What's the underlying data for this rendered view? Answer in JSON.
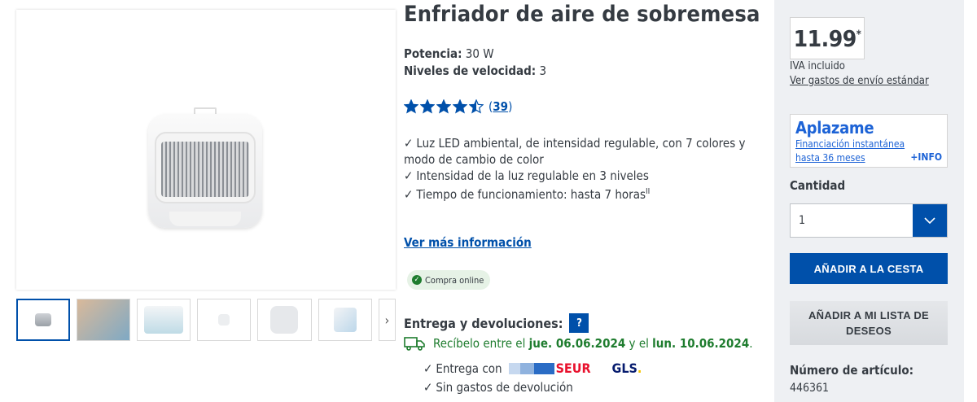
{
  "product": {
    "title": "Enfriador de aire de sobremesa",
    "specs": [
      {
        "label": "Potencia:",
        "value": "30 W"
      },
      {
        "label": "Niveles de velocidad:",
        "value": "3"
      }
    ],
    "rating": {
      "value": 4.5,
      "max": 5,
      "count": "39"
    },
    "features": [
      "Luz LED ambiental, de intensidad regulable, con 7 colores y modo de cambio de color",
      "Intensidad de la luz regulable en 3 niveles",
      "Tiempo de funcionamiento: hasta 7 horas"
    ],
    "feature_footnote": "II",
    "more_info": "Ver más información",
    "badge": "Compra online"
  },
  "delivery": {
    "heading": "Entrega y devoluciones:",
    "help": "?",
    "date_prefix": "Recíbelo entre el",
    "date_from": "jue. 06.06.2024",
    "date_mid": "y el",
    "date_to": "lun. 10.06.2024",
    "date_suffix": ".",
    "carrier_label": "Entrega con",
    "carrier1": "SEUR",
    "carrier2": "GLS",
    "carrier2_dot": ".",
    "returns": "Sin gastos de devolución"
  },
  "sidebar": {
    "price": "11.99",
    "price_mark": "*",
    "vat": "IVA incluido",
    "shipping_link": "Ver gastos de envío estándar",
    "financing": {
      "brand": "Aplazame",
      "line1": "Financiación instantánea",
      "line2": "hasta 36 meses",
      "info": "+INFO"
    },
    "quantity_label": "Cantidad",
    "quantity_value": "1",
    "add_to_cart": "AÑADIR A LA CESTA",
    "add_to_wishlist_1": "AÑADIR A MI LISTA DE",
    "add_to_wishlist_2": "DESEOS",
    "article_label": "Número de artículo:",
    "article_number": "446361"
  },
  "icons": {
    "star": "star-icon",
    "check": "check-icon",
    "truck": "truck-icon",
    "chevron": "chevron-down-icon"
  },
  "colors": {
    "primary": "#0050aa",
    "green": "#1e7c2e",
    "star": "#0050aa"
  }
}
